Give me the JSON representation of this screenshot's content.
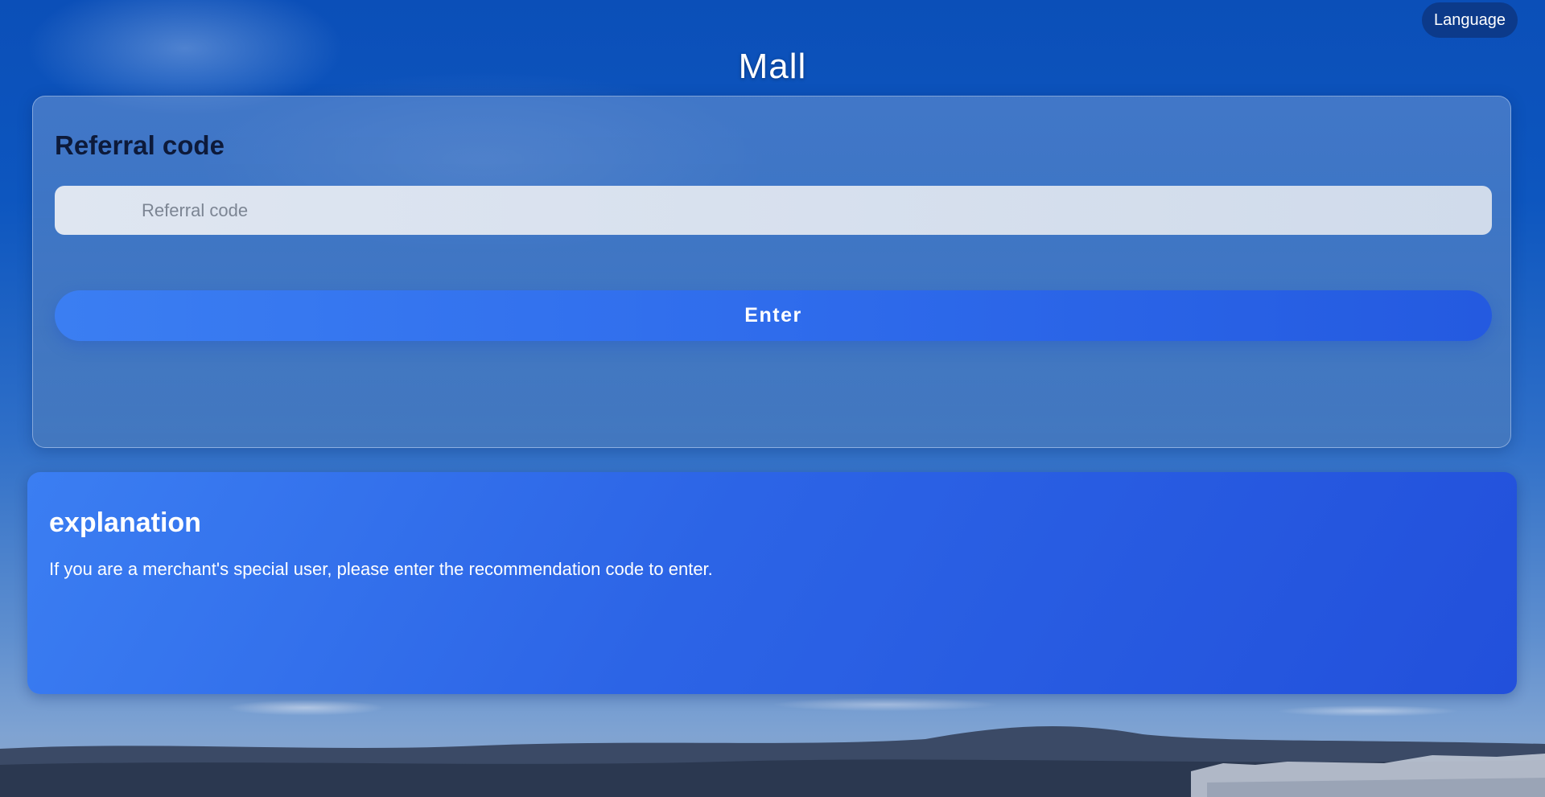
{
  "header": {
    "language_label": "Language",
    "title": "Mall"
  },
  "referral": {
    "heading": "Referral code",
    "input_placeholder": "Referral code",
    "input_value": "",
    "enter_label": "Enter"
  },
  "explanation": {
    "heading": "explanation",
    "text": "If you are a merchant's special user, please enter the recommendation code to enter."
  },
  "colors": {
    "sky": "#0d56bf",
    "accent": "#2f6cec",
    "language_button": "#0c3a8a",
    "heading_dark": "#0d1a3a"
  }
}
